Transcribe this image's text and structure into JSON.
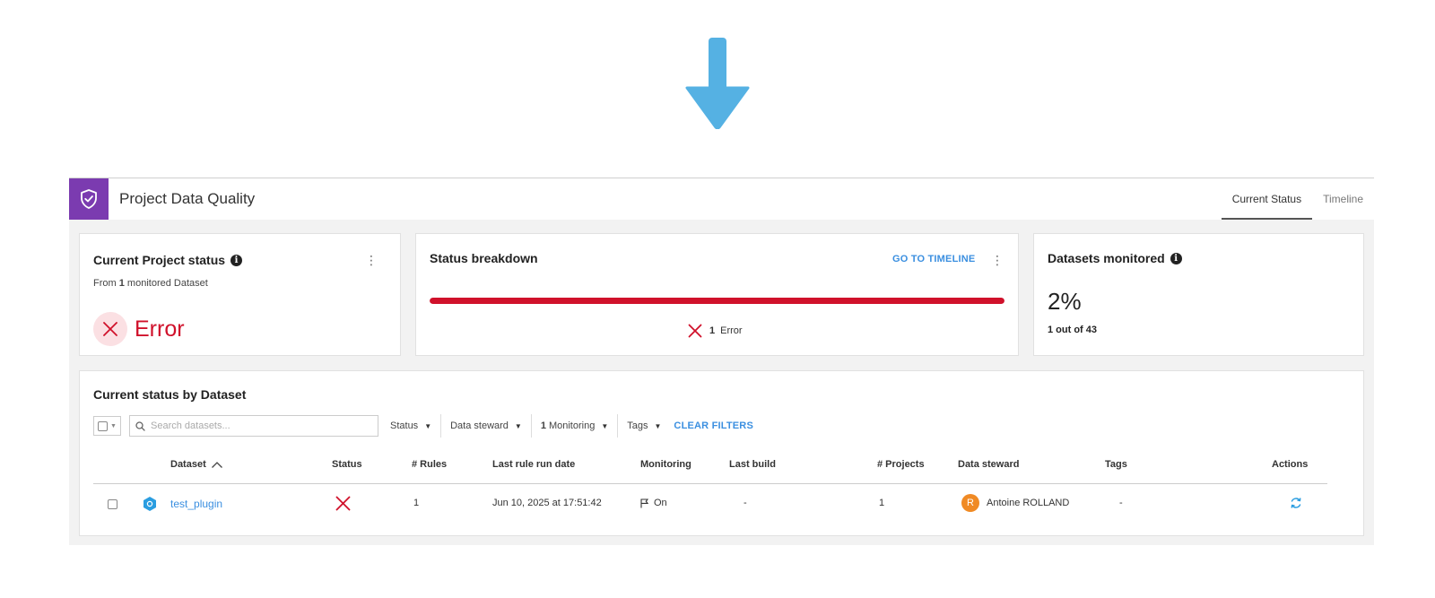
{
  "header": {
    "title": "Project Data Quality",
    "tabs": [
      {
        "label": "Current Status",
        "active": true
      },
      {
        "label": "Timeline",
        "active": false
      }
    ],
    "brand_color": "#7b3bb0"
  },
  "project_status": {
    "title": "Current Project status",
    "subtitle_prefix": "From",
    "subtitle_count": "1",
    "subtitle_suffix": "monitored Dataset",
    "status_label": "Error",
    "status_color": "#d0112b"
  },
  "status_breakdown": {
    "title": "Status breakdown",
    "link_label": "GO TO TIMELINE",
    "error_fraction": 1.0,
    "legend_count": "1",
    "legend_label": "Error"
  },
  "datasets_monitored": {
    "title": "Datasets monitored",
    "percent": "2%",
    "detail": "1 out of 43"
  },
  "by_dataset": {
    "title": "Current status by Dataset",
    "search_placeholder": "Search datasets...",
    "filters": {
      "status": "Status",
      "data_steward": "Data steward",
      "monitoring_count": "1",
      "monitoring": "Monitoring",
      "tags": "Tags"
    },
    "clear_filters": "CLEAR FILTERS",
    "columns": {
      "dataset": "Dataset",
      "status": "Status",
      "rules": "# Rules",
      "last_run": "Last rule run date",
      "monitoring": "Monitoring",
      "last_build": "Last build",
      "projects": "# Projects",
      "steward": "Data steward",
      "tags": "Tags",
      "actions": "Actions"
    },
    "rows": [
      {
        "dataset": "test_plugin",
        "status": "error",
        "rules": "1",
        "last_run": "Jun 10, 2025 at 17:51:42",
        "monitoring": "On",
        "last_build": "-",
        "projects": "1",
        "steward_initial": "R",
        "steward": "Antoine ROLLAND",
        "tags": "-"
      }
    ]
  },
  "colors": {
    "accent_link": "#3b8fe0",
    "error": "#d0112b",
    "arrow": "#55b1e3",
    "avatar": "#f08a24"
  }
}
